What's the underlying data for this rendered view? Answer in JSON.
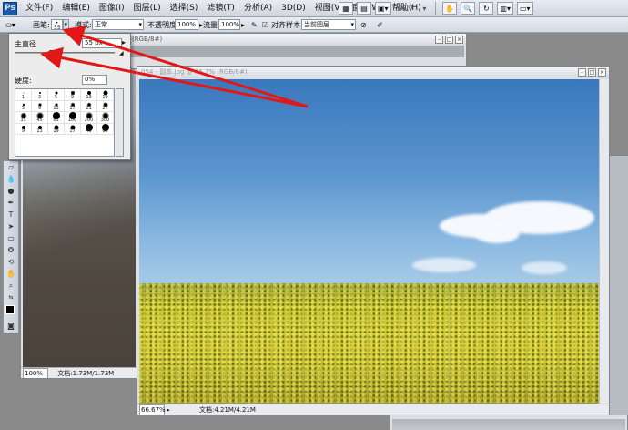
{
  "app": {
    "logo": "Ps"
  },
  "menu": [
    "文件(F)",
    "编辑(E)",
    "图像(I)",
    "图层(L)",
    "选择(S)",
    "滤镜(T)",
    "分析(A)",
    "3D(D)",
    "视图(V)",
    "窗口(W)",
    "帮助(H)"
  ],
  "menu_tools": {
    "zoom": "66.7",
    "zoom_arrow": "▾"
  },
  "options": {
    "brush_label": "画笔:",
    "brush_size": "55",
    "mode_label": "模式:",
    "mode_value": "正常",
    "opacity_label": "不透明度:",
    "opacity_value": "100%",
    "flow_label": "流量:",
    "flow_value": "100%",
    "align_label": "对齐",
    "sample_label": "样本:",
    "sample_value": "当前图层"
  },
  "brush_picker": {
    "diameter_label": "主直径",
    "diameter_value": "55 px",
    "hardness_label": "硬度:",
    "hardness_value": "0%",
    "presets": [
      {
        "size": 1,
        "label": "1",
        "soft": false
      },
      {
        "size": 3,
        "label": "3",
        "soft": false
      },
      {
        "size": 5,
        "label": "5",
        "soft": false
      },
      {
        "size": 9,
        "label": "9",
        "soft": false
      },
      {
        "size": 13,
        "label": "13",
        "soft": false
      },
      {
        "size": 19,
        "label": "19",
        "soft": false
      },
      {
        "size": 5,
        "label": "5",
        "soft": true
      },
      {
        "size": 9,
        "label": "9",
        "soft": true
      },
      {
        "size": 13,
        "label": "13",
        "soft": true
      },
      {
        "size": 17,
        "label": "17",
        "soft": true
      },
      {
        "size": 21,
        "label": "21",
        "soft": true
      },
      {
        "size": 27,
        "label": "27",
        "soft": true
      },
      {
        "size": 35,
        "label": "35",
        "soft": true
      },
      {
        "size": 45,
        "label": "45",
        "soft": true
      },
      {
        "size": 65,
        "label": "65",
        "soft": false
      },
      {
        "size": 100,
        "label": "100",
        "soft": false
      },
      {
        "size": 200,
        "label": "200",
        "soft": true
      },
      {
        "size": 300,
        "label": "300",
        "soft": true
      },
      {
        "size": 9,
        "label": "9",
        "soft": false
      },
      {
        "size": 13,
        "label": "13",
        "soft": false
      },
      {
        "size": 19,
        "label": "19",
        "soft": false
      },
      {
        "size": 17,
        "label": "17",
        "soft": false
      },
      {
        "size": 45,
        "label": "45",
        "soft": false
      },
      {
        "size": 65,
        "label": "65",
        "soft": false
      }
    ]
  },
  "docs": {
    "back_title": "(RGB/8#)",
    "back_zoom": "100%",
    "back_info": "文档:1.73M/1.73M",
    "main_title": "054 - 副本.jpg @ 66.7% (RGB/8#)",
    "main_zoom": "66.67%",
    "main_info": "文档:4.21M/4.21M"
  },
  "colors": {
    "arrow": "#e01818",
    "sky_top": "#3a78bd",
    "field": "#c9c436"
  }
}
